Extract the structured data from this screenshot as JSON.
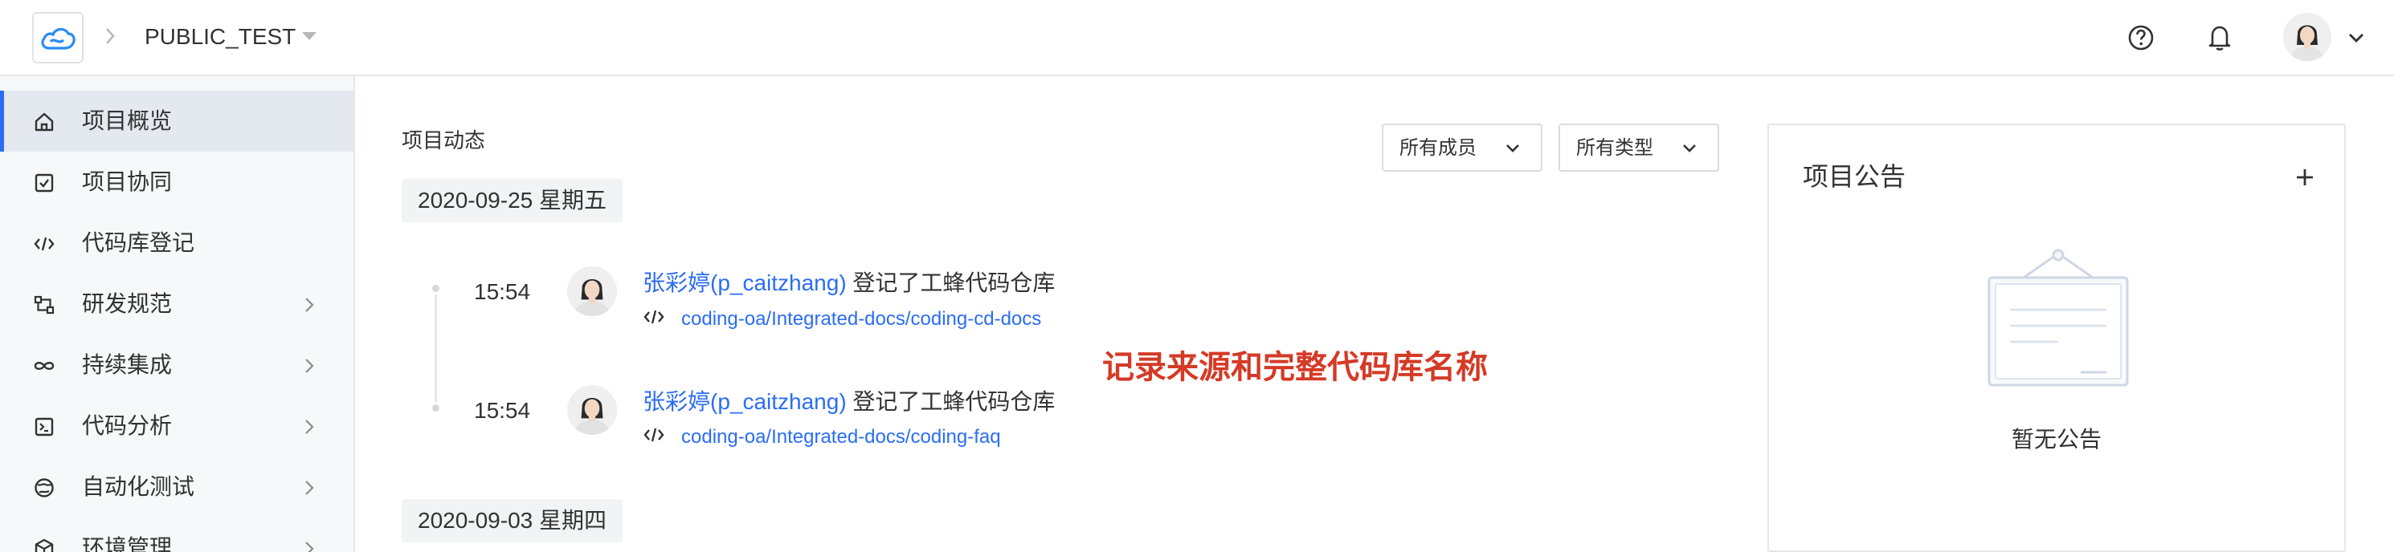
{
  "header": {
    "project_name": "PUBLIC_TEST",
    "icons": [
      "cloud-logo-icon",
      "chevron-right-icon",
      "caret-down-icon",
      "help-icon",
      "bell-icon",
      "avatar",
      "chevron-down-icon"
    ]
  },
  "sidebar": {
    "items": [
      {
        "label": "项目概览",
        "icon": "home-icon",
        "active": true,
        "has_children": false
      },
      {
        "label": "项目协同",
        "icon": "checkbox-icon",
        "active": false,
        "has_children": false
      },
      {
        "label": "代码库登记",
        "icon": "code-icon",
        "active": false,
        "has_children": false
      },
      {
        "label": "研发规范",
        "icon": "flow-icon",
        "active": false,
        "has_children": true
      },
      {
        "label": "持续集成",
        "icon": "infinity-icon",
        "active": false,
        "has_children": true
      },
      {
        "label": "代码分析",
        "icon": "terminal-icon",
        "active": false,
        "has_children": true
      },
      {
        "label": "自动化测试",
        "icon": "test-icon",
        "active": false,
        "has_children": true
      },
      {
        "label": "环境管理",
        "icon": "cube-icon",
        "active": false,
        "has_children": true
      }
    ]
  },
  "activity": {
    "title": "项目动态",
    "filters": {
      "members": "所有成员",
      "types": "所有类型"
    },
    "groups": [
      {
        "date": "2020-09-25 星期五",
        "events": [
          {
            "time": "15:54",
            "user": "张彩婷(p_caitzhang)",
            "action": " 登记了工蜂代码仓库",
            "repo": "coding-oa/Integrated-docs/coding-cd-docs"
          },
          {
            "time": "15:54",
            "user": "张彩婷(p_caitzhang)",
            "action": " 登记了工蜂代码仓库",
            "repo": "coding-oa/Integrated-docs/coding-faq"
          }
        ]
      },
      {
        "date": "2020-09-03 星期四",
        "events": []
      }
    ],
    "annotation": "记录来源和完整代码库名称"
  },
  "notice": {
    "title": "项目公告",
    "empty_text": "暂无公告"
  },
  "colors": {
    "accent": "#2a6df4",
    "annotation": "#d43a26",
    "sidebar_bg": "#f7f8fa",
    "sidebar_active": "#e4e8ef"
  }
}
